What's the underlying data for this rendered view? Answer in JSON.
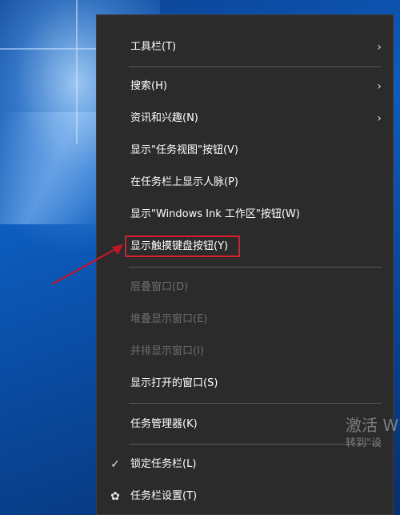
{
  "menu": {
    "items": [
      {
        "label": "工具栏(T)",
        "submenu": true,
        "enabled": true
      },
      {
        "label": "搜索(H)",
        "submenu": true,
        "enabled": true
      },
      {
        "label": "资讯和兴趣(N)",
        "submenu": true,
        "enabled": true
      },
      {
        "label": "显示\"任务视图\"按钮(V)",
        "enabled": true
      },
      {
        "label": "在任务栏上显示人脉(P)",
        "enabled": true
      },
      {
        "label": "显示\"Windows Ink 工作区\"按钮(W)",
        "enabled": true
      },
      {
        "label": "显示触摸键盘按钮(Y)",
        "enabled": true,
        "highlighted": true
      },
      {
        "label": "层叠窗口(D)",
        "enabled": false
      },
      {
        "label": "堆叠显示窗口(E)",
        "enabled": false
      },
      {
        "label": "并排显示窗口(I)",
        "enabled": false
      },
      {
        "label": "显示打开的窗口(S)",
        "enabled": true
      },
      {
        "label": "任务管理器(K)",
        "enabled": true
      },
      {
        "label": "锁定任务栏(L)",
        "enabled": true,
        "checked": true
      },
      {
        "label": "任务栏设置(T)",
        "enabled": true,
        "icon": "gear-icon"
      }
    ],
    "chevron_glyph": "›",
    "check_glyph": "✓",
    "gear_glyph": "✿"
  },
  "watermark": {
    "line1": "激活 W",
    "line2": "转到\"设"
  },
  "colors": {
    "menu_bg": "#2b2b2b",
    "highlight_border": "#d81e2a",
    "arrow": "#c0182a"
  }
}
